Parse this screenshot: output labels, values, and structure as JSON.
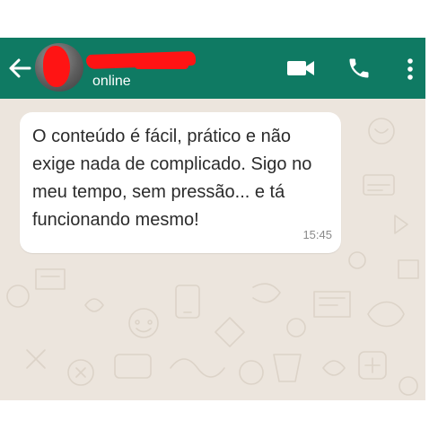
{
  "header": {
    "status": "online",
    "icons": {
      "back": "arrow-left-icon",
      "video": "video-camera-icon",
      "call": "phone-icon",
      "more": "more-vertical-icon"
    }
  },
  "message": {
    "text": "O conteúdo é fácil, prático e não exige nada de complicado. Sigo no meu tempo, sem pressão... e tá funcionando mesmo!",
    "time": "15:45"
  },
  "colors": {
    "header": "#0f7a63",
    "background": "#ece5dd",
    "bubble": "#ffffff",
    "redaction": "#ff1414"
  }
}
